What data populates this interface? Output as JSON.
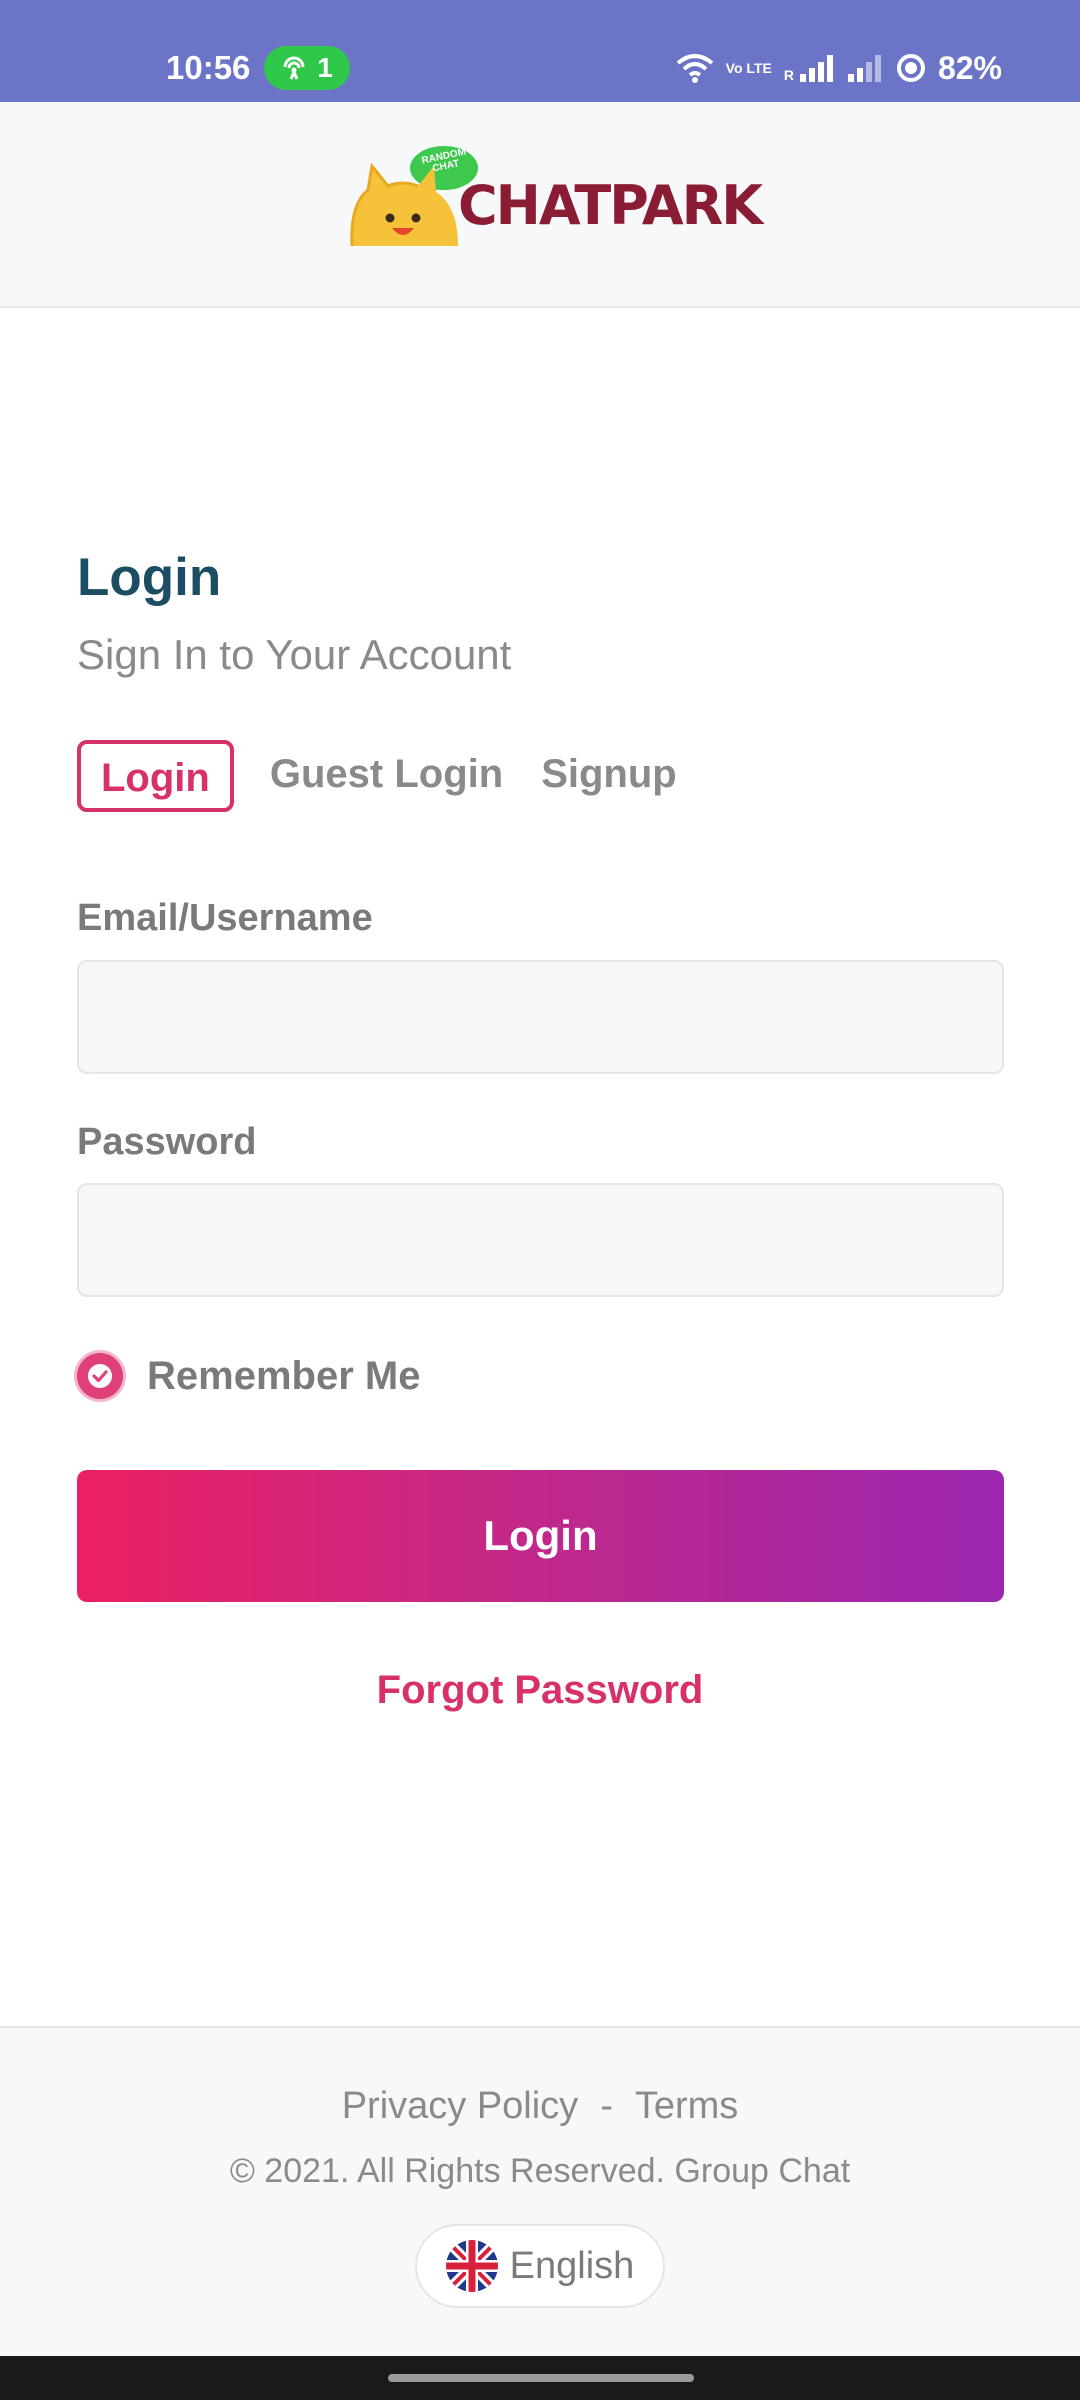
{
  "status_bar": {
    "time": "10:56",
    "hotspot_count": "1",
    "volte": "Vo LTE",
    "roaming": "R",
    "battery": "82%"
  },
  "header": {
    "logo_text": "CHATPARK",
    "logo_bubble_text": "RANDOM CHAT"
  },
  "login": {
    "title": "Login",
    "subtitle": "Sign In to Your Account",
    "tabs": [
      {
        "label": "Login",
        "active": true
      },
      {
        "label": "Guest Login",
        "active": false
      },
      {
        "label": "Signup",
        "active": false
      }
    ],
    "email_label": "Email/Username",
    "email_value": "",
    "password_label": "Password",
    "password_value": "",
    "remember_label": "Remember Me",
    "remember_checked": true,
    "submit_label": "Login",
    "forgot_label": "Forgot Password"
  },
  "footer": {
    "privacy_label": "Privacy Policy",
    "separator": "-",
    "terms_label": "Terms",
    "copyright": "© 2021. All Rights Reserved. Group Chat",
    "language_label": "English"
  },
  "colors": {
    "status_bar": "#6b74c6",
    "accent": "#d8306a",
    "title": "#1c4e63",
    "button_gradient_start": "#ec1f62",
    "button_gradient_end": "#9b26b0"
  },
  "icons": [
    "hotspot-icon",
    "wifi-icon",
    "signal-icon",
    "battery-saver-icon",
    "checkmark-icon",
    "uk-flag-icon"
  ]
}
